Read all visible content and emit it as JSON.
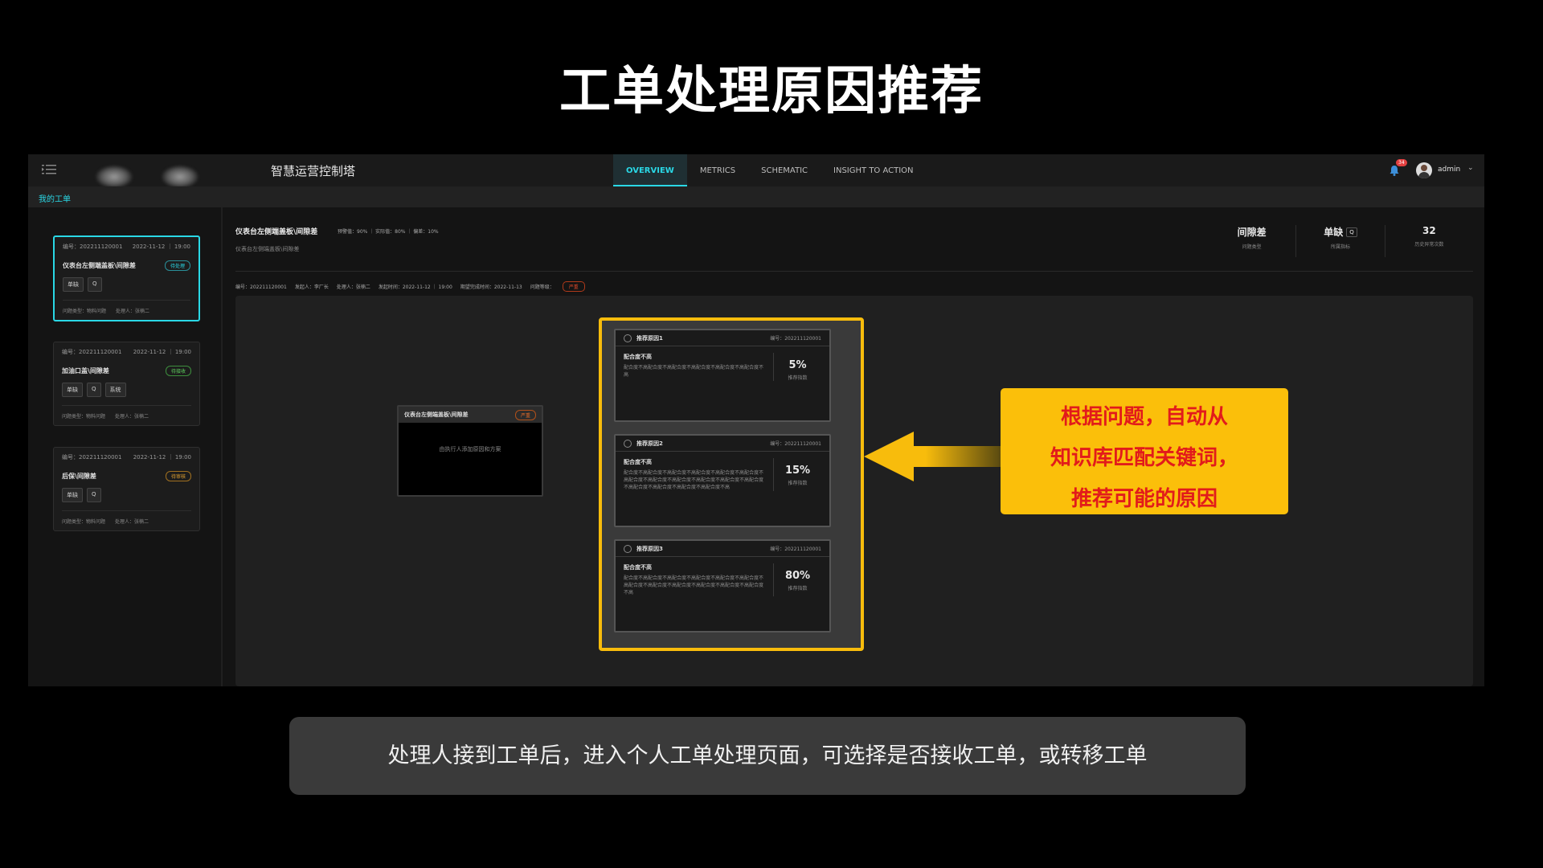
{
  "slide": {
    "title": "工单处理原因推荐",
    "caption": "处理人接到工单后，进入个人工单处理页面，可选择是否接收工单，或转移工单"
  },
  "app": {
    "title": "智慧运营控制塔",
    "tabs": [
      {
        "label": "OVERVIEW",
        "active": true
      },
      {
        "label": "METRICS",
        "active": false
      },
      {
        "label": "SCHEMATIC",
        "active": false
      },
      {
        "label": "INSIGHT TO ACTION",
        "active": false
      }
    ],
    "notification_count": "34",
    "user": "admin",
    "section_title": "我的工单"
  },
  "tickets": [
    {
      "number": "编号：202211120001",
      "date": "2022-11-12 ｜ 19:00",
      "title": "仪表台左侧端盖板\\间隙差",
      "status": "待处理",
      "tags": [
        "单缺",
        "Q"
      ],
      "problem_type": "问题类型：物料问题",
      "handler": "处理人：张楠二"
    },
    {
      "number": "编号：202211120001",
      "date": "2022-11-12 ｜ 19:00",
      "title": "加油口盖\\间隙差",
      "status": "待接收",
      "tags": [
        "单缺",
        "Q",
        "系统"
      ],
      "problem_type": "问题类型：物料问题",
      "handler": "处理人：张楠二"
    },
    {
      "number": "编号：202211120001",
      "date": "2022-11-12 ｜ 19:00",
      "title": "后保\\间隙差",
      "status": "待审核",
      "tags": [
        "单缺",
        "Q"
      ],
      "problem_type": "问题类型：物料问题",
      "handler": "处理人：张楠二"
    }
  ],
  "detail": {
    "title": "仪表台左侧端盖板\\间隙差",
    "metrics": "预警值：90% ｜ 实际值：80% ｜ 偏差：10%",
    "subtitle": "仪表台左侧端盖板\\间隙差",
    "stats": [
      {
        "value": "间隙差",
        "label": "问题类型"
      },
      {
        "value": "单缺",
        "badge": "Q",
        "label": "所属指标"
      },
      {
        "value": "32",
        "label": "历史异常次数"
      }
    ],
    "info": [
      "编号：202211120001",
      "发起人：李厂长",
      "处理人：张楠二",
      "发起时间：2022-11-12 ｜ 19:00",
      "期望完成时间：2022-11-13",
      "问题等级："
    ],
    "severity": "严重"
  },
  "node": {
    "title": "仪表台左侧端盖板\\间隙差",
    "severity": "严重",
    "body": "由执行人添加原因和方案"
  },
  "reasons": [
    {
      "title": "推荐原因1",
      "number": "编号：202211120001",
      "subtitle": "配合度不高",
      "desc": "配合度不高配合度不高配合度不高配合度不高配合度不高配合度不高",
      "pct": "5%",
      "pct_label": "推荐指数"
    },
    {
      "title": "推荐原因2",
      "number": "编号：202211120001",
      "subtitle": "配合度不高",
      "desc": "配合度不高配合度不高配合度不高配合度不高配合度不高配合度不高配合度不高配合度不高配合度不高配合度不高配合度不高配合度不高配合度不高配合度不高配合度不高配合度不高",
      "pct": "15%",
      "pct_label": "推荐指数"
    },
    {
      "title": "推荐原因3",
      "number": "编号：202211120001",
      "subtitle": "配合度不高",
      "desc": "配合度不高配合度不高配合度不高配合度不高配合度不高配合度不高配合度不高配合度不高配合度不高配合度不高配合度不高配合度不高",
      "pct": "80%",
      "pct_label": "推荐指数"
    }
  ],
  "callout": {
    "lines": [
      "根据问题，自动从",
      "知识库匹配关键词，",
      "推荐可能的原因"
    ]
  },
  "colors": {
    "accent": "#2ad8e6",
    "highlight": "#f8bc0c",
    "callout_text": "#e21b1b"
  }
}
